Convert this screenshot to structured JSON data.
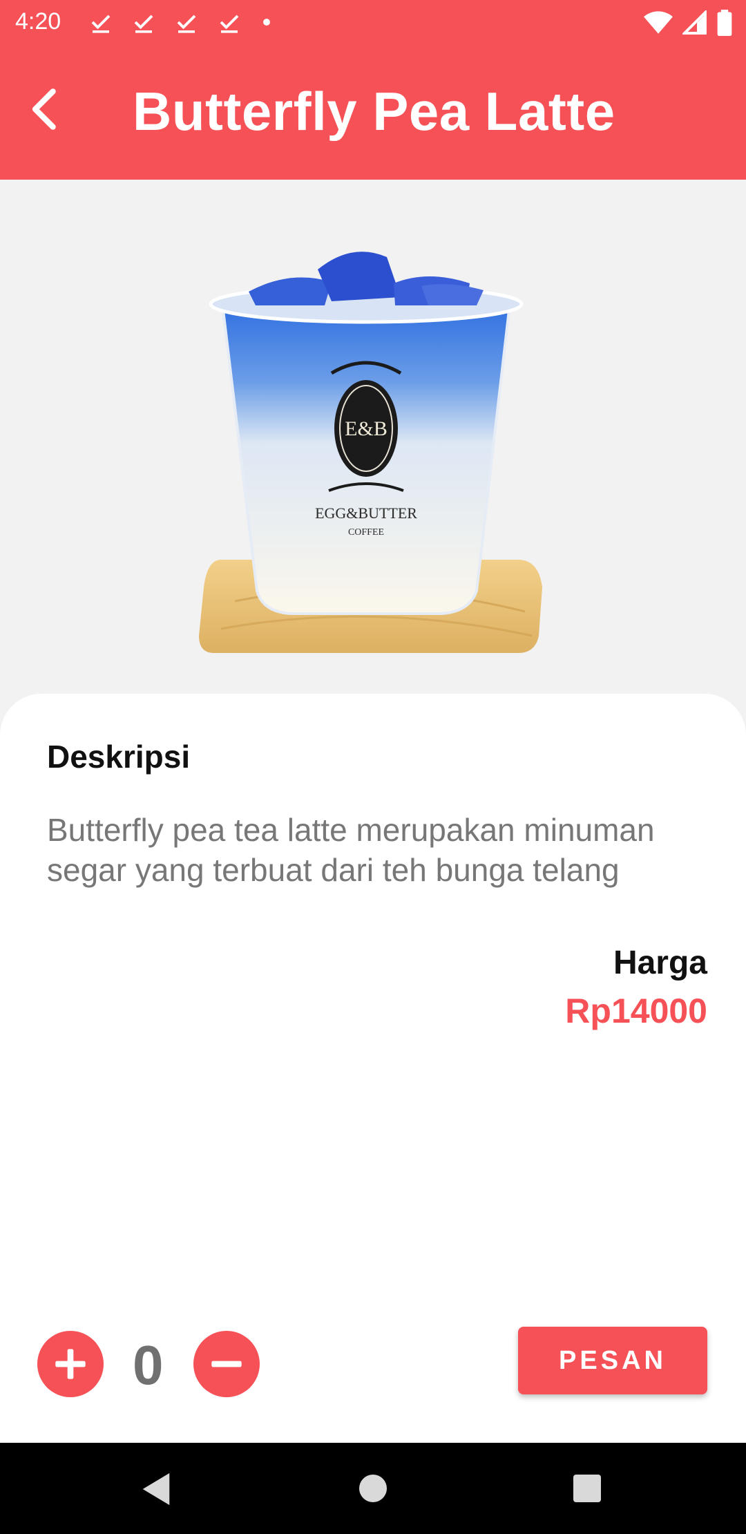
{
  "status_bar": {
    "time": "4:20",
    "left_icons": [
      "download-done-icon",
      "download-done-icon",
      "download-done-icon",
      "download-done-icon",
      "dot-icon"
    ],
    "right_icons": [
      "wifi-icon",
      "signal-icon",
      "battery-icon"
    ]
  },
  "app_bar": {
    "back_icon": "chevron-left-icon",
    "title": "Butterfly Pea Latte"
  },
  "product": {
    "image_icon": "iced-drink-cup-image",
    "image_logo_text": "EGG&BUTTER COFFEE"
  },
  "details": {
    "description_title": "Deskripsi",
    "description_text": "Butterfly pea tea latte merupakan minuman segar yang terbuat dari teh bunga telang",
    "price_label": "Harga",
    "price_value": "Rp14000"
  },
  "order": {
    "plus_icon": "plus-icon",
    "quantity": "0",
    "minus_icon": "minus-icon",
    "order_label": "PESAN"
  },
  "colors": {
    "accent": "#f65157",
    "card": "#ffffff",
    "background": "#f2f2f2",
    "muted_text": "#777777"
  },
  "nav_bar": {
    "icons": [
      "nav-back-icon",
      "nav-home-icon",
      "nav-recents-icon"
    ]
  }
}
